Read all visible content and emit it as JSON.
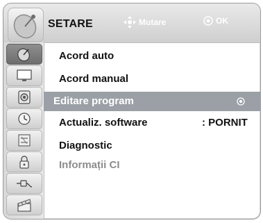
{
  "header": {
    "title": "SETARE",
    "hint_move_label": "Mutare",
    "hint_ok_label": "OK",
    "logo_icon": "satellite-dish-icon"
  },
  "sidebar": {
    "items": [
      {
        "icon": "satellite-dish-icon",
        "active": true
      },
      {
        "icon": "monitor-icon",
        "active": false
      },
      {
        "icon": "speaker-icon",
        "active": false
      },
      {
        "icon": "clock-icon",
        "active": false
      },
      {
        "icon": "options-icon",
        "active": false
      },
      {
        "icon": "lock-icon",
        "active": false
      },
      {
        "icon": "input-plug-icon",
        "active": false
      },
      {
        "icon": "media-clapper-icon",
        "active": false
      }
    ]
  },
  "menu": {
    "items": [
      {
        "label": "Acord auto",
        "value": ""
      },
      {
        "label": "Acord manual",
        "value": ""
      },
      {
        "label": "Editare program",
        "value": "",
        "highlighted": true
      },
      {
        "label": "Actualiz. software",
        "value": ": PORNIT"
      },
      {
        "label": "Diagnostic",
        "value": ""
      },
      {
        "label": "Informații CI",
        "value": "",
        "disabled": true
      }
    ]
  },
  "colors": {
    "highlight": "#9aa0a6",
    "sidebar_active": "#7a7a7a",
    "text": "#111111",
    "disabled_text": "#8c8c8c"
  }
}
